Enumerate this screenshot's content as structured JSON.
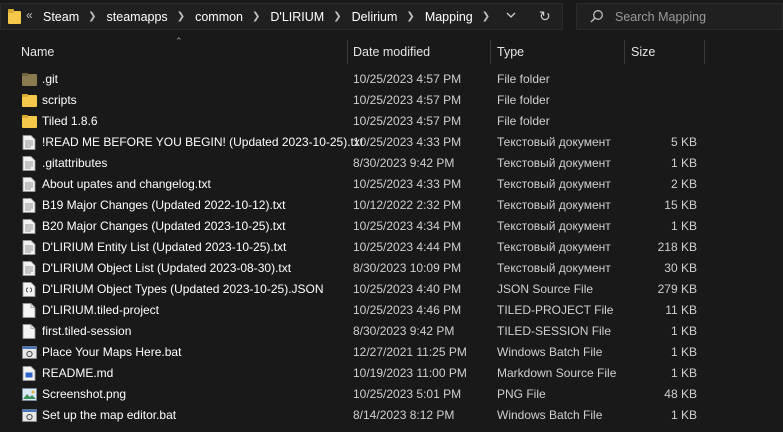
{
  "breadcrumb": {
    "overflow": "«",
    "items": [
      "Steam",
      "steamapps",
      "common",
      "D'LIRIUM",
      "Delirium",
      "Mapping"
    ]
  },
  "search": {
    "placeholder": "Search Mapping"
  },
  "columns": {
    "name": "Name",
    "date": "Date modified",
    "type": "Type",
    "size": "Size"
  },
  "files": [
    {
      "name": ".git",
      "date": "10/25/2023 4:57 PM",
      "type": "File folder",
      "size": "",
      "icon": "folder-dark-icon"
    },
    {
      "name": "scripts",
      "date": "10/25/2023 4:57 PM",
      "type": "File folder",
      "size": "",
      "icon": "folder-icon"
    },
    {
      "name": "Tiled 1.8.6",
      "date": "10/25/2023 4:57 PM",
      "type": "File folder",
      "size": "",
      "icon": "folder-icon"
    },
    {
      "name": "!READ ME BEFORE YOU BEGIN! (Updated 2023-10-25).txt",
      "date": "10/25/2023 4:33 PM",
      "type": "Текстовый документ",
      "size": "5 KB",
      "icon": "text-file-icon"
    },
    {
      "name": ".gitattributes",
      "date": "8/30/2023 9:42 PM",
      "type": "Текстовый документ",
      "size": "1 KB",
      "icon": "text-file-icon"
    },
    {
      "name": "About upates and changelog.txt",
      "date": "10/25/2023 4:33 PM",
      "type": "Текстовый документ",
      "size": "2 KB",
      "icon": "text-file-icon"
    },
    {
      "name": "B19 Major Changes (Updated 2022-10-12).txt",
      "date": "10/12/2022 2:32 PM",
      "type": "Текстовый документ",
      "size": "15 KB",
      "icon": "text-file-icon"
    },
    {
      "name": "B20 Major Changes (Updated 2023-10-25).txt",
      "date": "10/25/2023 4:34 PM",
      "type": "Текстовый документ",
      "size": "1 KB",
      "icon": "text-file-icon"
    },
    {
      "name": "D'LIRIUM Entity List (Updated 2023-10-25).txt",
      "date": "10/25/2023 4:44 PM",
      "type": "Текстовый документ",
      "size": "218 KB",
      "icon": "text-file-icon"
    },
    {
      "name": "D'LIRIUM Object List (Updated 2023-08-30).txt",
      "date": "8/30/2023 10:09 PM",
      "type": "Текстовый документ",
      "size": "30 KB",
      "icon": "text-file-icon"
    },
    {
      "name": "D'LIRIUM Object Types (Updated 2023-10-25).JSON",
      "date": "10/25/2023 4:40 PM",
      "type": "JSON Source File",
      "size": "279 KB",
      "icon": "json-file-icon"
    },
    {
      "name": "D'LIRIUM.tiled-project",
      "date": "10/25/2023 4:46 PM",
      "type": "TILED-PROJECT File",
      "size": "11 KB",
      "icon": "blank-file-icon"
    },
    {
      "name": "first.tiled-session",
      "date": "8/30/2023 9:42 PM",
      "type": "TILED-SESSION File",
      "size": "1 KB",
      "icon": "blank-file-icon"
    },
    {
      "name": "Place Your Maps Here.bat",
      "date": "12/27/2021 11:25 PM",
      "type": "Windows Batch File",
      "size": "1 KB",
      "icon": "batch-file-icon"
    },
    {
      "name": "README.md",
      "date": "10/19/2023 11:00 PM",
      "type": "Markdown Source File",
      "size": "1 KB",
      "icon": "markdown-file-icon"
    },
    {
      "name": "Screenshot.png",
      "date": "10/25/2023 5:01 PM",
      "type": "PNG File",
      "size": "48 KB",
      "icon": "image-file-icon"
    },
    {
      "name": "Set up the map editor.bat",
      "date": "8/14/2023 8:12 PM",
      "type": "Windows Batch File",
      "size": "1 KB",
      "icon": "batch-file-icon"
    }
  ],
  "colors": {
    "background": "#191919",
    "folder": "#f4c84a",
    "folder_dark": "#8a7a50",
    "text": "#ffffff",
    "secondary_text": "#cfcfcf"
  }
}
